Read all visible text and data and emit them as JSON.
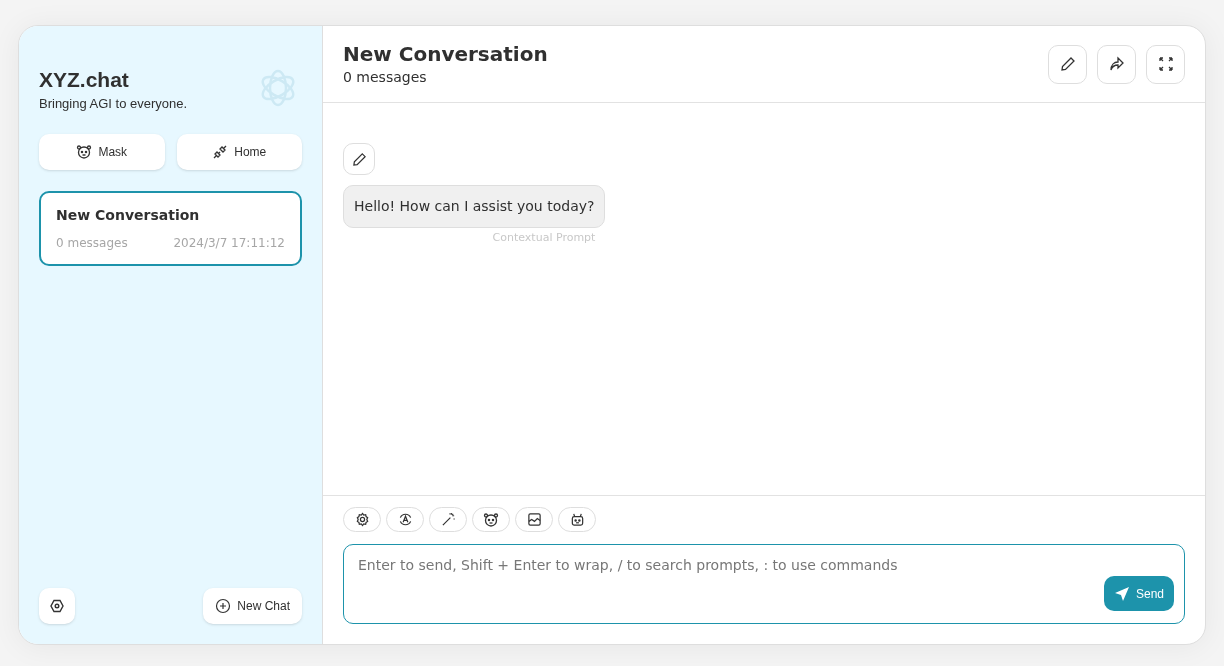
{
  "sidebar": {
    "title": "XYZ.chat",
    "subtitle": "Bringing AGI to everyone.",
    "buttons": [
      {
        "kind": "mask",
        "label": "Mask"
      },
      {
        "kind": "home",
        "label": "Home"
      }
    ],
    "conversations": [
      {
        "title": "New Conversation",
        "count": "0 messages",
        "time": "2024/3/7 17:11:12",
        "selected": true
      }
    ],
    "new_chat": "New Chat"
  },
  "header": {
    "title": "New Conversation",
    "subtitle": "0 messages"
  },
  "messages": [
    {
      "text": "Hello! How can I assist you today?",
      "note": "Contextual Prompt"
    }
  ],
  "toolbar": [
    {
      "kind": "settings"
    },
    {
      "kind": "theme"
    },
    {
      "kind": "wand"
    },
    {
      "kind": "mask"
    },
    {
      "kind": "image"
    },
    {
      "kind": "robot"
    }
  ],
  "input": {
    "placeholder": "Enter to send, Shift + Enter to wrap, / to search prompts, : to use commands"
  },
  "send": "Send"
}
